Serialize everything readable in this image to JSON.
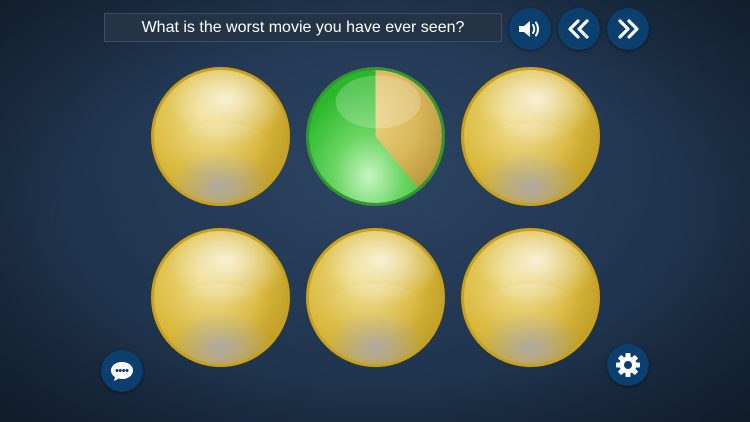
{
  "question": {
    "text": "What is the worst movie you have ever seen?"
  },
  "toolbar": {
    "speaker_icon": "speaker-icon",
    "previous_icon": "double-chevron-left-icon",
    "next_icon": "double-chevron-right-icon"
  },
  "bubbles": [
    {
      "state": "unrevealed"
    },
    {
      "state": "revealing",
      "progress": 0.61
    },
    {
      "state": "unrevealed"
    },
    {
      "state": "unrevealed"
    },
    {
      "state": "unrevealed"
    },
    {
      "state": "unrevealed"
    }
  ],
  "footer": {
    "chat_icon": "chat-bubble-icon",
    "settings_icon": "gear-icon"
  },
  "colors": {
    "button_bg": "#0a3f6e",
    "gold": "#d9b83c",
    "progress_green": "#2fbf2f"
  }
}
